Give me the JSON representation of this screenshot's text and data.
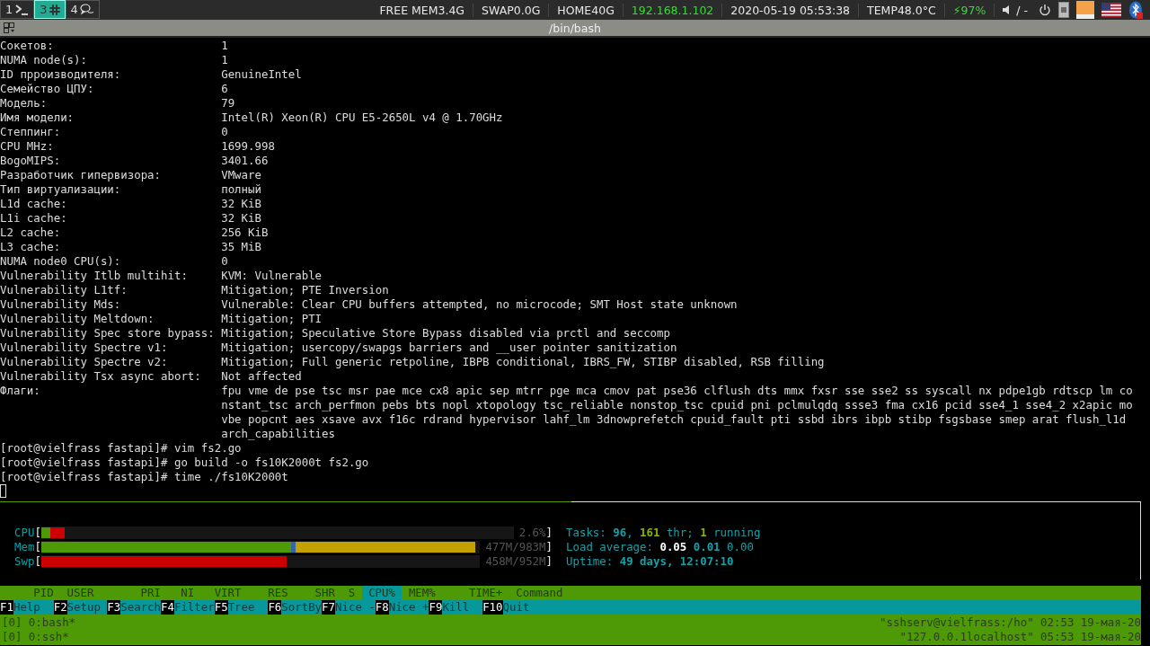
{
  "top_bar": {
    "workspaces": [
      {
        "number": "1",
        "selected": false
      },
      {
        "number": "3",
        "selected": true
      },
      {
        "number": "4",
        "selected": false
      }
    ],
    "status": [
      {
        "text": "FREE MEM3.4G",
        "kind": "plain"
      },
      {
        "text": "SWAP0.0G",
        "kind": "plain"
      },
      {
        "text": "HOME40G",
        "kind": "plain"
      },
      {
        "text": "192.168.1.102",
        "kind": "good"
      },
      {
        "text": "2020-05-19 05:53:38",
        "kind": "plain"
      },
      {
        "text": "TEMP48.0°C",
        "kind": "plain"
      },
      {
        "text": "⚡97%",
        "kind": "good"
      }
    ],
    "volume": "/ -"
  },
  "pane_title": "/bin/bash",
  "terminal": {
    "info": [
      {
        "key": "Сокетов:",
        "value": "1"
      },
      {
        "key": "NUMA node(s):",
        "value": "1"
      },
      {
        "key": "ID прроизводителя:",
        "value": "GenuineIntel"
      },
      {
        "key": "Семейство ЦПУ:",
        "value": "6"
      },
      {
        "key": "Модель:",
        "value": "79"
      },
      {
        "key": "Имя модели:",
        "value": "Intel(R) Xeon(R) CPU E5-2650L v4 @ 1.70GHz"
      },
      {
        "key": "Степпинг:",
        "value": "0"
      },
      {
        "key": "CPU MHz:",
        "value": "1699.998"
      },
      {
        "key": "BogoMIPS:",
        "value": "3401.66"
      },
      {
        "key": "Разработчик гипервизора:",
        "value": "VMware"
      },
      {
        "key": "Тип виртуализации:",
        "value": "полный"
      },
      {
        "key": "L1d cache:",
        "value": "32 KiB"
      },
      {
        "key": "L1i cache:",
        "value": "32 KiB"
      },
      {
        "key": "L2 cache:",
        "value": "256 KiB"
      },
      {
        "key": "L3 cache:",
        "value": "35 MiB"
      },
      {
        "key": "NUMA node0 CPU(s):",
        "value": "0"
      },
      {
        "key": "Vulnerability Itlb multihit:",
        "value": "KVM: Vulnerable"
      },
      {
        "key": "Vulnerability L1tf:",
        "value": "Mitigation; PTE Inversion"
      },
      {
        "key": "Vulnerability Mds:",
        "value": "Vulnerable: Clear CPU buffers attempted, no microcode; SMT Host state unknown"
      },
      {
        "key": "Vulnerability Meltdown:",
        "value": "Mitigation; PTI"
      },
      {
        "key": "Vulnerability Spec store bypass:",
        "value": "Mitigation; Speculative Store Bypass disabled via prctl and seccomp"
      },
      {
        "key": "Vulnerability Spectre v1:",
        "value": "Mitigation; usercopy/swapgs barriers and __user pointer sanitization"
      },
      {
        "key": "Vulnerability Spectre v2:",
        "value": "Mitigation; Full generic retpoline, IBPB conditional, IBRS_FW, STIBP disabled, RSB filling"
      },
      {
        "key": "Vulnerability Tsx async abort:",
        "value": "Not affected"
      }
    ],
    "flags": {
      "key": "Флаги:",
      "lines": [
        "fpu vme de pse tsc msr pae mce cx8 apic sep mtrr pge mca cmov pat pse36 clflush dts mmx fxsr sse sse2 ss syscall nx pdpe1gb rdtscp lm co",
        "nstant_tsc arch_perfmon pebs bts nopl xtopology tsc_reliable nonstop_tsc cpuid pni pclmulqdq ssse3 fma cx16 pcid sse4_1 sse4_2 x2apic mo",
        "vbe popcnt aes xsave avx f16c rdrand hypervisor lahf_lm 3dnowprefetch cpuid_fault pti ssbd ibrs ibpb stibp fsgsbase smep arat flush_l1d",
        "arch_capabilities"
      ]
    },
    "commands": [
      {
        "prompt": "[root@vielfrass fastapi]#",
        "command": "vim fs2.go"
      },
      {
        "prompt": "[root@vielfrass fastapi]#",
        "command": "go build -o fs10K2000t fs2.go"
      },
      {
        "prompt": "[root@vielfrass fastapi]#",
        "command": "time ./fs10K2000t"
      }
    ]
  },
  "htop": {
    "meters": [
      {
        "label": "CPU",
        "open": "[",
        "close": "]",
        "reading": "2.6%",
        "segments": [
          {
            "level": 0.02,
            "color": "#4e9a06"
          },
          {
            "level": 0.03,
            "color": "#cc0000"
          }
        ]
      },
      {
        "label": "Mem",
        "open": "[",
        "close": "]",
        "reading": "477M/983M",
        "segments": [
          {
            "level": 0.57,
            "color": "#4e9a06"
          },
          {
            "level": 0.01,
            "color": "#3465a4"
          },
          {
            "level": 0.41,
            "color": "#c4a000"
          }
        ]
      },
      {
        "label": "Swp",
        "open": "[",
        "close": "]",
        "reading": "458M/952M",
        "segments": [
          {
            "level": 0.56,
            "color": "#cc0000"
          }
        ]
      }
    ],
    "stats": [
      [
        {
          "text": "Tasks: ",
          "kind": "label"
        },
        {
          "text": "96",
          "kind": "value"
        },
        {
          "text": ", ",
          "kind": "label"
        },
        {
          "text": "161",
          "kind": "green"
        },
        {
          "text": " thr; ",
          "kind": "label"
        },
        {
          "text": "1",
          "kind": "green"
        },
        {
          "text": " running",
          "kind": "label"
        }
      ],
      [
        {
          "text": "Load average: ",
          "kind": "label"
        },
        {
          "text": "0.05",
          "kind": "bright"
        },
        {
          "text": " 0.01",
          "kind": "value"
        },
        {
          "text": " 0.00",
          "kind": "label"
        }
      ],
      [
        {
          "text": "Uptime: ",
          "kind": "label"
        },
        {
          "text": "49 days, 12:07:10",
          "kind": "value"
        }
      ]
    ],
    "columns": [
      {
        "label": "PID",
        "selected": false
      },
      {
        "label": "USER",
        "selected": false
      },
      {
        "label": "PRI",
        "selected": false
      },
      {
        "label": "NI",
        "selected": false
      },
      {
        "label": "VIRT",
        "selected": false
      },
      {
        "label": "RES",
        "selected": false
      },
      {
        "label": "SHR",
        "selected": false
      },
      {
        "label": "S",
        "selected": false
      },
      {
        "label": "CPU%",
        "selected": true
      },
      {
        "label": "MEM%",
        "selected": false
      },
      {
        "label": "TIME+",
        "selected": false
      },
      {
        "label": "Command",
        "selected": false
      }
    ],
    "function_keys": [
      {
        "key": "F1",
        "label": "Help"
      },
      {
        "key": "F2",
        "label": "Setup"
      },
      {
        "key": "F3",
        "label": "Search"
      },
      {
        "key": "F4",
        "label": "Filter"
      },
      {
        "key": "F5",
        "label": "Tree"
      },
      {
        "key": "F6",
        "label": "SortBy"
      },
      {
        "key": "F7",
        "label": "Nice -"
      },
      {
        "key": "F8",
        "label": "Nice +"
      },
      {
        "key": "F9",
        "label": "Kill"
      },
      {
        "key": "F10",
        "label": "Quit"
      }
    ]
  },
  "tmux_status": [
    {
      "window": "[0] 0:bash*",
      "title": "\"sshserv@vielfrass:/ho\" 02:53 19-мая-20"
    },
    {
      "window": "[0] 0:ssh*",
      "title": "\"127.0.0.1localhost\" 05:53 19-мая-20"
    }
  ]
}
